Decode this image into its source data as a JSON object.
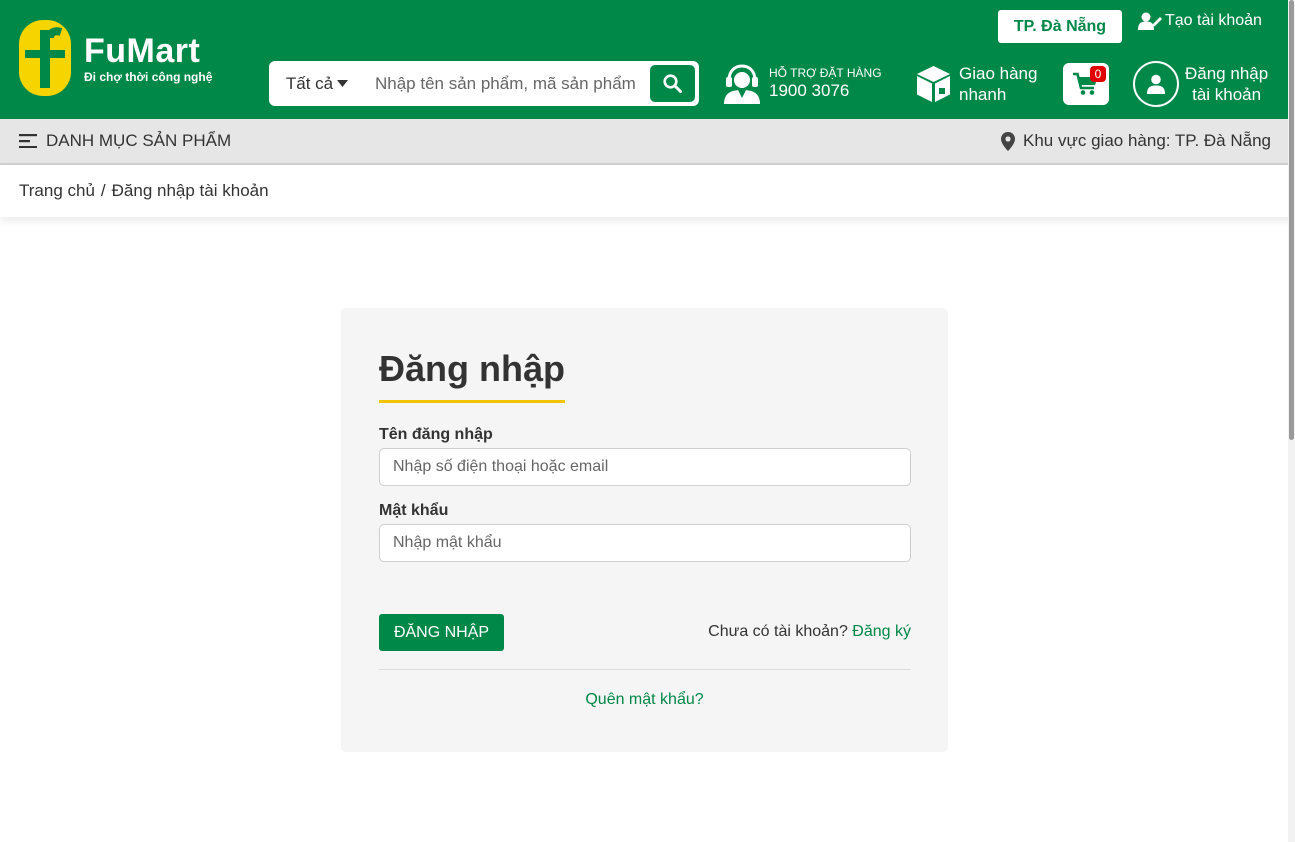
{
  "colors": {
    "brand_green": "#008848",
    "accent_yellow": "#f5c400",
    "badge_red": "#e00000"
  },
  "header": {
    "logo": {
      "name": "FuMart",
      "tagline": "Đi chợ thời công nghệ",
      "icon": "logo-f-icon"
    },
    "city_button": "TP. Đà Nẵng",
    "create_account": {
      "label": "Tạo tài khoản",
      "icon": "user-plus-icon"
    },
    "search": {
      "category": "Tất cả",
      "placeholder": "Nhập tên sản phẩm, mã sản phẩm",
      "icon": "search-icon"
    },
    "support": {
      "label": "HỖ TRỢ ĐẶT HÀNG",
      "phone": "1900 3076",
      "icon": "headset-icon"
    },
    "delivery": {
      "line1": "Giao hàng",
      "line2": "nhanh",
      "icon": "box-icon"
    },
    "cart": {
      "count": "0",
      "icon": "cart-icon"
    },
    "login": {
      "line1": "Đăng nhập",
      "line2": "tài khoản",
      "icon": "user-icon"
    }
  },
  "category_bar": {
    "menu_label": "DANH MỤC SẢN PHẨM",
    "region_label": "Khu vực giao hàng: TP. Đà Nẵng"
  },
  "breadcrumb": {
    "home": "Trang chủ",
    "separator": "/",
    "current": "Đăng nhập tài khoản"
  },
  "login_form": {
    "title": "Đăng nhập",
    "username_label": "Tên đăng nhập",
    "username_placeholder": "Nhập số điện thoại hoặc email",
    "username_value": "",
    "password_label": "Mật khẩu",
    "password_placeholder": "Nhập mật khẩu",
    "password_value": "",
    "submit_label": "ĐĂNG NHẬP",
    "no_account_text": "Chưa có tài khoản?",
    "register_link": "Đăng ký",
    "forgot_link": "Quên mật khẩu?"
  }
}
